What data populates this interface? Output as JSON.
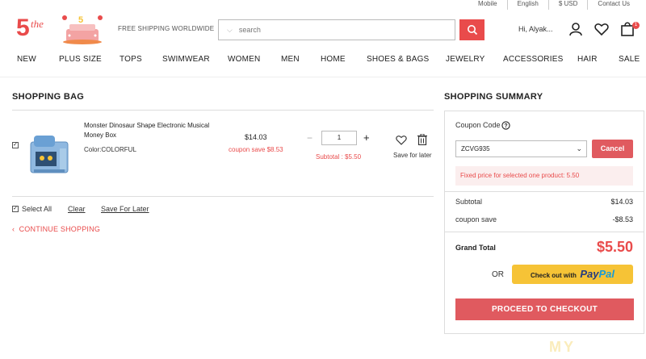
{
  "topbar": {
    "links": [
      "Mobile",
      "English",
      "$ USD",
      "Contact Us"
    ]
  },
  "header": {
    "logo_text": "the",
    "logo_sub": "5",
    "shipping": "FREE SHIPPING WORLDWIDE",
    "search_placeholder": "search",
    "greeting": "Hi, Alyak...",
    "bag_count": "1"
  },
  "nav": {
    "items": [
      "NEW",
      "PLUS SIZE",
      "TOPS",
      "SWIMWEAR",
      "WOMEN",
      "MEN",
      "HOME",
      "SHOES & BAGS",
      "JEWELRY",
      "ACCESSORIES",
      "HAIR",
      "SALE"
    ]
  },
  "bag": {
    "title": "SHOPPING BAG",
    "item": {
      "checked_mark": "✓",
      "name": "Monster Dinosaur Shape Electronic Musical Money Box",
      "color": "Color:COLORFUL",
      "price": "$14.03",
      "coupon_save": "coupon save $8.53",
      "qty_minus": "−",
      "qty": "1",
      "qty_plus": "+",
      "subtotal": "Subtotal : $5.50",
      "save_for_later": "Save for later"
    },
    "select_all": "Select All",
    "clear": "Clear",
    "save_for_later_link": "Save For Later",
    "continue": "CONTINUE SHOPPING",
    "continue_chevron": "‹"
  },
  "summary": {
    "title": "SHOPPING SUMMARY",
    "coupon_label": "Coupon Code",
    "coupon_value": "ZCVG935",
    "coupon_caret": "⌄",
    "cancel": "Cancel",
    "fixed_note": "Fixed price for selected one product: 5.50",
    "subtotal_label": "Subtotal",
    "subtotal_value": "$14.03",
    "coupon_save_label": "coupon save",
    "coupon_save_value": "-$8.53",
    "grand_total_label": "Grand Total",
    "grand_total_value": "$5.50",
    "or": "OR",
    "paypal_prefix": "Check out with",
    "paypal_brand_1": "Pay",
    "paypal_brand_2": "Pal",
    "checkout": "PROCEED TO CHECKOUT"
  },
  "watermark": "MY",
  "colors": {
    "accent": "#e94b4b",
    "button_red": "#e05a5f",
    "paypal_yellow": "#f6c336"
  }
}
